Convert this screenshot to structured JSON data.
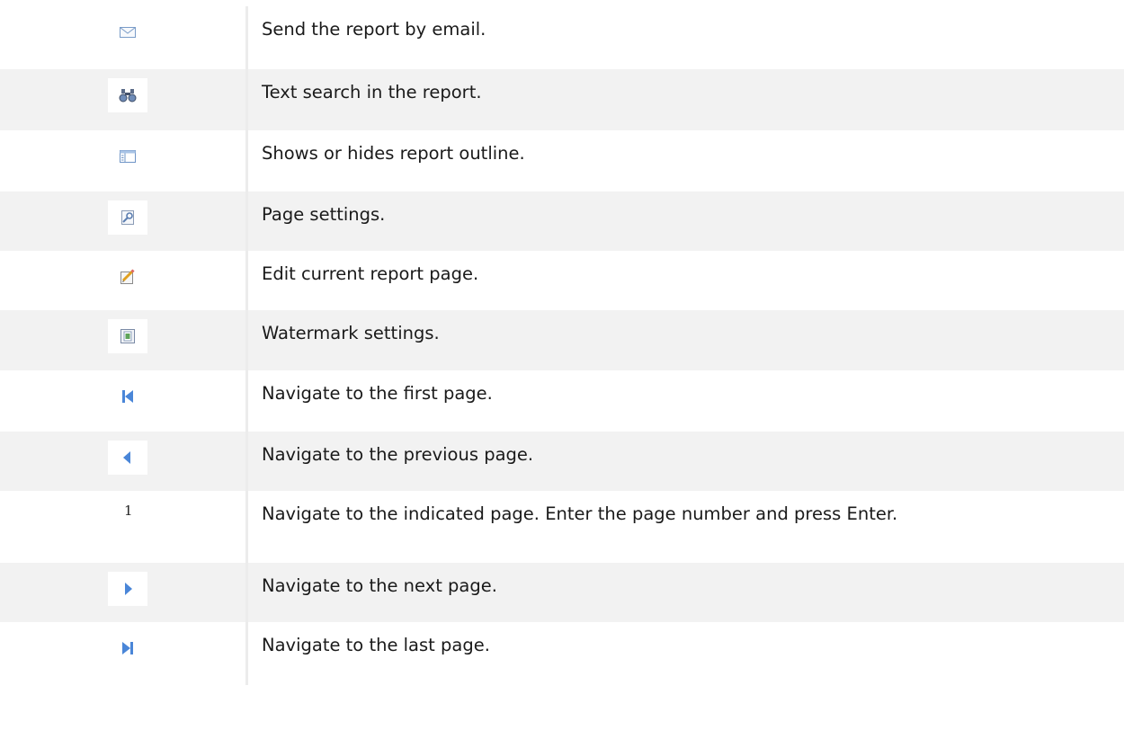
{
  "rows": [
    {
      "icon": "envelope-icon",
      "text": "Send the report by email."
    },
    {
      "icon": "binoculars-icon",
      "text": "Text search in the report."
    },
    {
      "icon": "outline-panel-icon",
      "text": "Shows or hides report outline."
    },
    {
      "icon": "page-settings-icon",
      "text": "Page settings."
    },
    {
      "icon": "edit-page-icon",
      "text": "Edit current report page."
    },
    {
      "icon": "watermark-icon",
      "text": "Watermark settings."
    },
    {
      "icon": "first-page-icon",
      "text": "Navigate to the first page."
    },
    {
      "icon": "previous-page-icon",
      "text": "Navigate to the previous page."
    },
    {
      "icon": "page-number",
      "value": "1",
      "text": "Navigate to the indicated page. Enter the page number and press Enter."
    },
    {
      "icon": "next-page-icon",
      "text": "Navigate to the next page."
    },
    {
      "icon": "last-page-icon",
      "text": "Navigate to the last page."
    }
  ],
  "colors": {
    "icon_blue": "#4a86d8",
    "row_alt": "#f2f2f2",
    "divider": "#ececec"
  }
}
